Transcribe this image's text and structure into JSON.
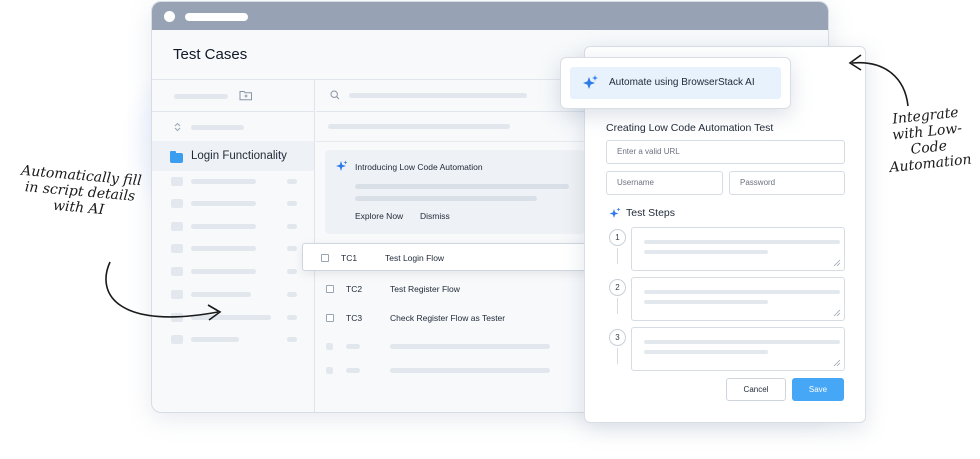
{
  "window": {
    "title": "Test Cases"
  },
  "sidebar": {
    "folder_label": "Login Functionality"
  },
  "banner": {
    "title": "Introducing Low Code Automation",
    "explore_label": "Explore Now",
    "dismiss_label": "Dismiss"
  },
  "test_cases": [
    {
      "id": "TC1",
      "name": "Test Login Flow"
    },
    {
      "id": "TC2",
      "name": "Test Register Flow"
    },
    {
      "id": "TC3",
      "name": "Check Register Flow as Tester"
    }
  ],
  "automate_button": {
    "label": "Automate using BrowserStack AI"
  },
  "panel": {
    "title": "Creating Low Code Automation Test",
    "url_placeholder": "Enter a valid URL",
    "username_placeholder": "Username",
    "password_placeholder": "Password",
    "steps_title": "Test Steps",
    "steps": [
      "1",
      "2",
      "3"
    ],
    "cancel_label": "Cancel",
    "save_label": "Save"
  },
  "annotations": {
    "left": "Automatically fill in script details with AI",
    "right": "Integrate with Low-Code Automation"
  },
  "colors": {
    "accent": "#45a7f5",
    "folder": "#3a9df0",
    "titlebar": "#97a3b4",
    "sparkle": "#2e7be8"
  }
}
